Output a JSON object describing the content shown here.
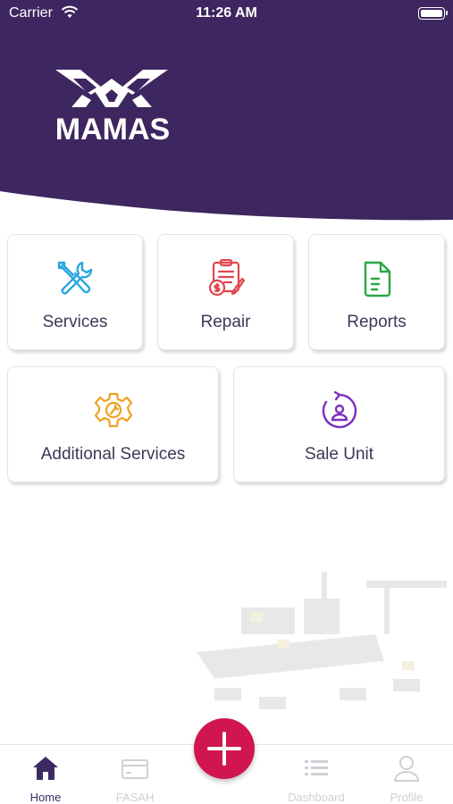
{
  "status_bar": {
    "carrier": "Carrier",
    "time": "11:26 AM"
  },
  "brand": {
    "name": "MAMAS",
    "header_color": "#3e2660",
    "accent_color": "#d0154f"
  },
  "tiles": [
    {
      "label": "Services",
      "icon": "tools-icon",
      "icon_color": "#2aa7e0"
    },
    {
      "label": "Repair",
      "icon": "repair-invoice-icon",
      "icon_color": "#e0464e"
    },
    {
      "label": "Reports",
      "icon": "document-icon",
      "icon_color": "#28a745"
    },
    {
      "label": "Additional Services",
      "icon": "gear-wrench-icon",
      "icon_color": "#f0a020"
    },
    {
      "label": "Sale Unit",
      "icon": "sale-person-icon",
      "icon_color": "#7b2fbf"
    }
  ],
  "tabbar": {
    "items": [
      {
        "label": "Home",
        "icon": "home-icon",
        "active": true
      },
      {
        "label": "FASAH",
        "icon": "card-icon",
        "active": false
      },
      {
        "label": "Dashboard",
        "icon": "list-icon",
        "active": false
      },
      {
        "label": "Profile",
        "icon": "person-icon",
        "active": false
      }
    ],
    "fab_icon": "plus-icon"
  }
}
